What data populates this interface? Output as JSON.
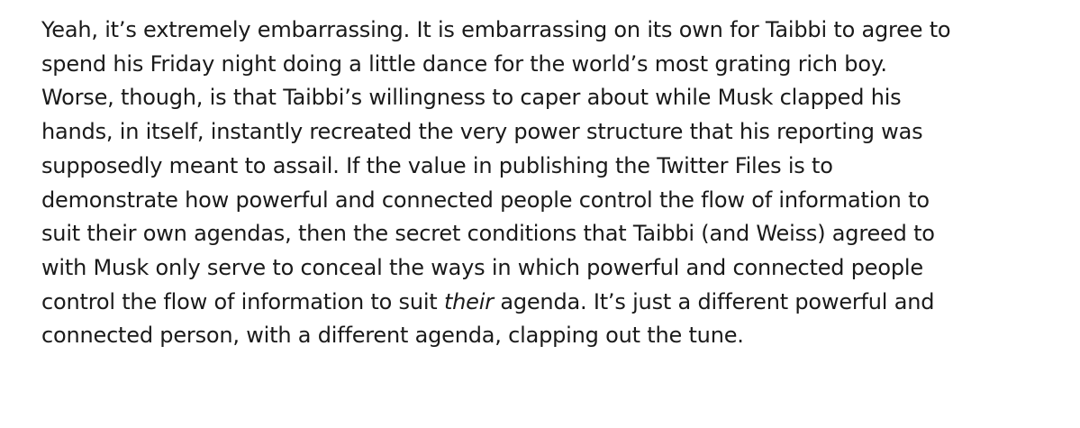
{
  "article": {
    "paragraph": {
      "lines": [
        "Yeah, it’s extremely embarrassing. It is embarrassing on its own for Taibbi to agree to",
        "spend his Friday night doing a little dance for the world’s most grating rich boy.",
        "Worse, though, is that Taibbi’s willingness to caper about while Musk clapped his",
        "hands, in itself, instantly recreated the very power structure that his reporting was",
        "supposedly meant to assail. If the value in publishing the Twitter Files is to",
        "demonstrate how powerful and connected people control the flow of information to",
        "suit their own agendas, then the secret conditions that Taibbi (and Weiss) agreed to",
        "with Musk only serve to conceal the ways in which powerful and connected people",
        {
          "before": "control the flow of information to suit ",
          "italic": "their",
          "after": " agenda. It’s just a different powerful and"
        },
        "connected person, with a different agenda, clapping out the tune."
      ]
    }
  }
}
